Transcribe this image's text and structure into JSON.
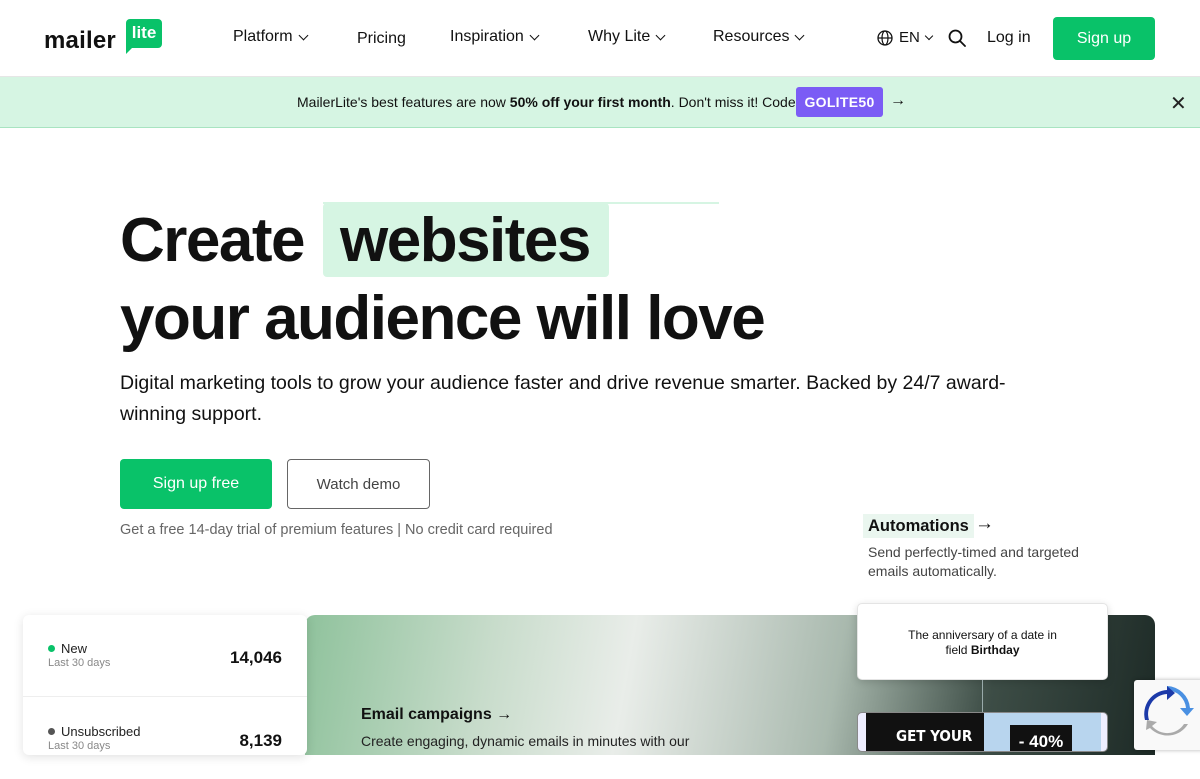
{
  "brand": {
    "logo_word": "mailer",
    "logo_badge": "lite"
  },
  "nav": {
    "items": [
      {
        "label": "Platform",
        "has_menu": true
      },
      {
        "label": "Pricing",
        "has_menu": false
      },
      {
        "label": "Inspiration",
        "has_menu": true
      },
      {
        "label": "Why Lite",
        "has_menu": true
      },
      {
        "label": "Resources",
        "has_menu": true
      }
    ],
    "language": "EN",
    "login": "Log in",
    "signup": "Sign up"
  },
  "banner": {
    "text_before": "MailerLite's best features are now ",
    "text_bold": "50% off your first month",
    "text_after": ". Don't miss it! Code:",
    "code": "GOLITE50",
    "arrow": "→",
    "close": "✕"
  },
  "hero": {
    "title_prefix": "Create",
    "title_highlight": "websites",
    "title_line2": "your audience will love",
    "subtitle": "Digital marketing tools to grow your audience faster and drive revenue smarter. Backed by 24/7 award-winning support.",
    "cta_primary": "Sign up free",
    "cta_secondary": "Watch demo",
    "note": "Get a free 14-day trial of premium features | No credit card required"
  },
  "automations": {
    "title": "Automations",
    "arrow": "→",
    "description": "Send perfectly-timed and targeted emails automatically."
  },
  "stats": [
    {
      "label": "New",
      "period": "Last 30 days",
      "value": "14,046",
      "dot_color": "#09c269"
    },
    {
      "label": "Unsubscribed",
      "period": "Last 30 days",
      "value": "8,139",
      "dot_color": "#555555"
    }
  ],
  "email_campaigns": {
    "title": "Email campaigns",
    "arrow": "→",
    "description": "Create engaging, dynamic emails in minutes with our"
  },
  "automation_card": {
    "line1": "The anniversary of a date in",
    "line2_prefix": "field ",
    "line2_bold": "Birthday"
  },
  "promo": {
    "left_text": "GET YOUR",
    "tag": "- 40%"
  },
  "colors": {
    "accent": "#09c269",
    "highlight": "#d6f5e3",
    "code_badge": "#7b5cf5"
  }
}
